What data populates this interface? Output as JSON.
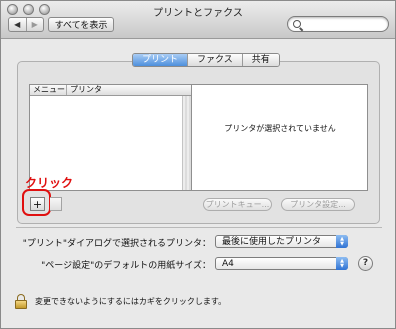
{
  "window": {
    "title": "プリントとファクス"
  },
  "toolbar": {
    "back_label": "◀",
    "forward_label": "▶",
    "show_all_label": "すべてを表示",
    "search_value": ""
  },
  "tabs": [
    {
      "label": "プリント",
      "active": true
    },
    {
      "label": "ファクス",
      "active": false
    },
    {
      "label": "共有",
      "active": false
    }
  ],
  "printer_list": {
    "columns": [
      "メニュー",
      "プリンタ"
    ],
    "rows": []
  },
  "detail": {
    "message": "プリンタが選択されていません"
  },
  "annotation": {
    "label": "クリック",
    "color": "#e01010"
  },
  "buttons": {
    "add_label": "+",
    "print_queue_label": "プリントキュー...",
    "printer_setup_label": "プリンタ設定..."
  },
  "settings": {
    "selected_printer_label": "\"プリント\"ダイアログで選択されるプリンタ：",
    "selected_printer_value": "最後に使用したプリンタ",
    "paper_size_label": "\"ページ設定\"のデフォルトの用紙サイズ：",
    "paper_size_value": "A4"
  },
  "help_label": "?",
  "footer": {
    "lock_text": "変更できないようにするにはカギをクリックします。"
  },
  "colors": {
    "accent": "#4d8fdc",
    "highlight": "#e01010"
  }
}
